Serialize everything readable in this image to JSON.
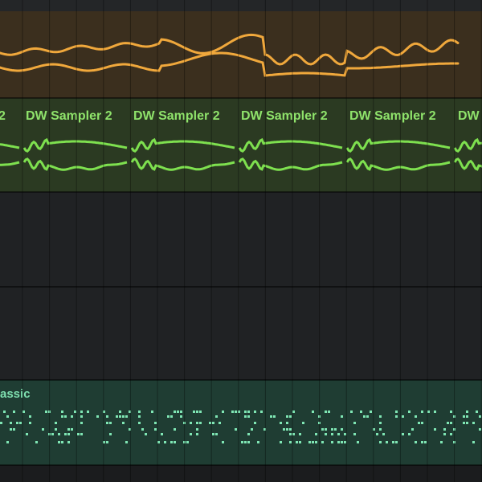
{
  "colors": {
    "orange_wave": "#f0a83c",
    "green_wave": "#7ee04f",
    "teal_notes": "#7fe6b4"
  },
  "tracks": {
    "green": {
      "clip_labels": [
        "2",
        "DW Sampler 2",
        "DW Sampler 2",
        "DW Sampler 2",
        "DW Sampler 2",
        "DW"
      ]
    },
    "teal": {
      "label": "assic"
    }
  }
}
